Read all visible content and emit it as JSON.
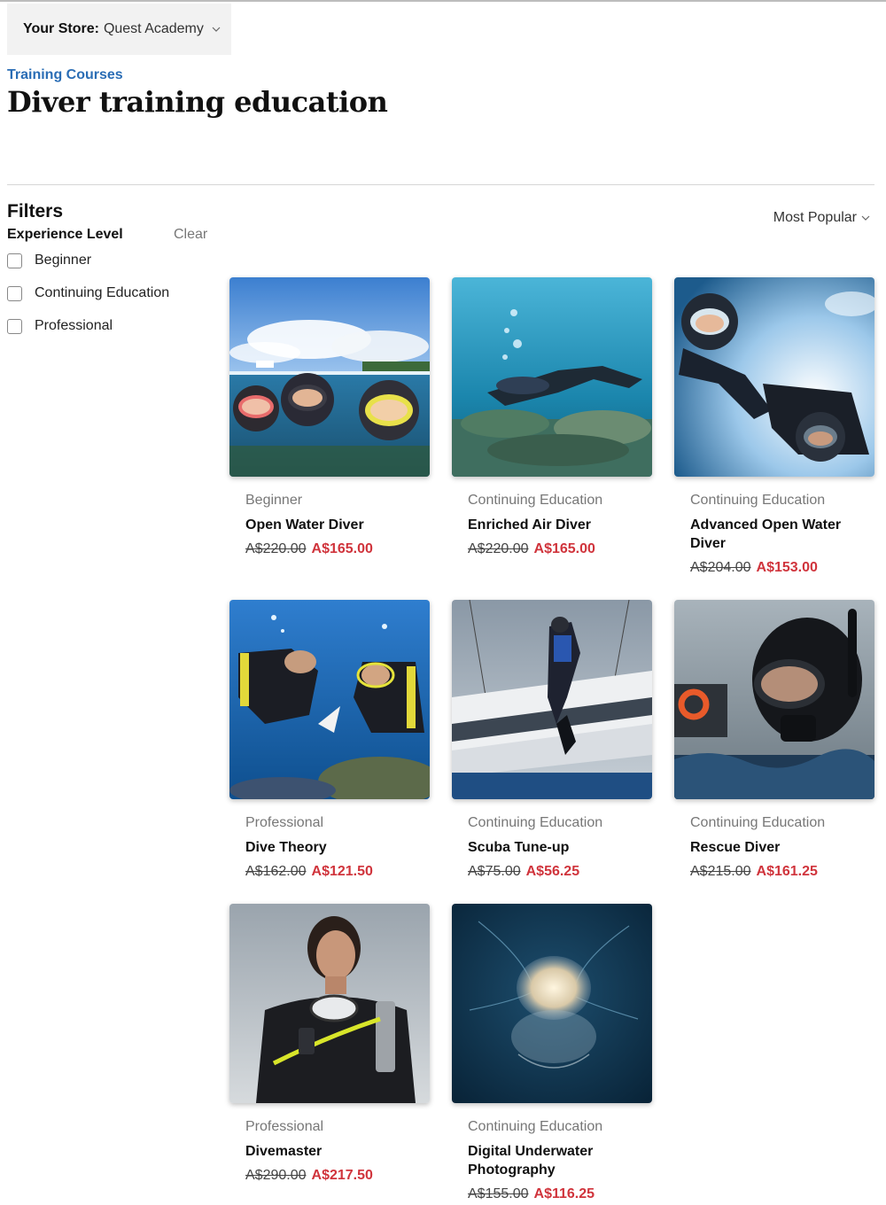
{
  "store": {
    "label": "Your Store:",
    "name": "Quest Academy"
  },
  "breadcrumb": "Training Courses",
  "page_title": "Diver training education",
  "filters": {
    "title": "Filters",
    "group_label": "Experience Level",
    "clear_label": "Clear",
    "options": [
      "Beginner",
      "Continuing Education",
      "Professional"
    ]
  },
  "sort": {
    "selected": "Most Popular"
  },
  "products": [
    {
      "category": "Beginner",
      "name": "Open Water Diver",
      "old_price": "A$220.00",
      "price": "A$165.00"
    },
    {
      "category": "Continuing Education",
      "name": "Enriched Air Diver",
      "old_price": "A$220.00",
      "price": "A$165.00"
    },
    {
      "category": "Continuing Education",
      "name": "Advanced Open Water Diver",
      "old_price": "A$204.00",
      "price": "A$153.00"
    },
    {
      "category": "Professional",
      "name": "Dive Theory",
      "old_price": "A$162.00",
      "price": "A$121.50"
    },
    {
      "category": "Continuing Education",
      "name": "Scuba Tune-up",
      "old_price": "A$75.00",
      "price": "A$56.25"
    },
    {
      "category": "Continuing Education",
      "name": "Rescue Diver",
      "old_price": "A$215.00",
      "price": "A$161.25"
    },
    {
      "category": "Professional",
      "name": "Divemaster",
      "old_price": "A$290.00",
      "price": "A$217.50"
    },
    {
      "category": "Continuing Education",
      "name": "Digital Underwater Photography",
      "old_price": "A$155.00",
      "price": "A$116.25"
    }
  ],
  "colors": {
    "link": "#2a6db5",
    "sale_price": "#d0343c",
    "store_bg": "#f2f2f2"
  }
}
